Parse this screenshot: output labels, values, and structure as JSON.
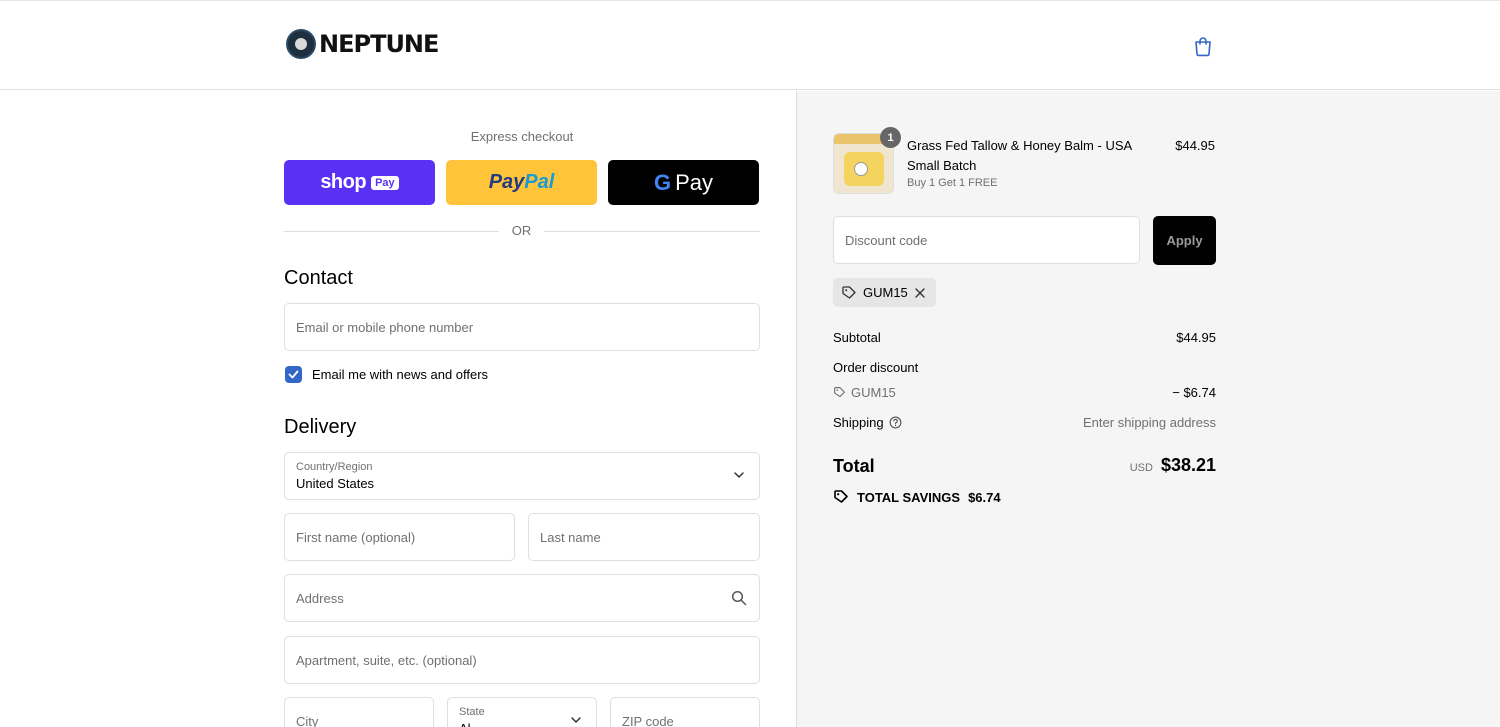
{
  "brand": {
    "name": "NEPTUNE"
  },
  "express": {
    "title": "Express checkout",
    "shop_pay": {
      "word": "shop",
      "badge": "Pay"
    },
    "paypal": {
      "part1": "Pay",
      "part2": "Pal"
    },
    "gpay": {
      "g": "G",
      "word": "Pay"
    },
    "or": "OR"
  },
  "contact": {
    "heading": "Contact",
    "email_placeholder": "Email or mobile phone number",
    "newsletter_label": "Email me with news and offers",
    "newsletter_checked": true
  },
  "delivery": {
    "heading": "Delivery",
    "country_label": "Country/Region",
    "country_value": "United States",
    "first_name_placeholder": "First name (optional)",
    "last_name_placeholder": "Last name",
    "address_placeholder": "Address",
    "apartment_placeholder": "Apartment, suite, etc. (optional)",
    "city_placeholder": "City",
    "state_label": "State",
    "state_value": "Al",
    "zip_placeholder": "ZIP code"
  },
  "cart": {
    "item": {
      "quantity": "1",
      "name": "Grass Fed Tallow & Honey Balm - USA Small Batch",
      "variant": "Buy 1 Get 1 FREE",
      "price": "$44.95"
    },
    "discount_placeholder": "Discount code",
    "apply_label": "Apply",
    "applied_code": "GUM15"
  },
  "summary": {
    "subtotal_label": "Subtotal",
    "subtotal_value": "$44.95",
    "order_discount_label": "Order discount",
    "discount_code": "GUM15",
    "discount_value": "− $6.74",
    "shipping_label": "Shipping",
    "shipping_value": "Enter shipping address",
    "total_label": "Total",
    "currency": "USD",
    "total_value": "$38.21",
    "savings_label": "TOTAL SAVINGS",
    "savings_value": "$6.74"
  },
  "colors": {
    "shop_pay": "#5a31f4",
    "paypal": "#ffc439",
    "checkbox": "#3367c7",
    "summary_bg": "#f5f5f5"
  }
}
